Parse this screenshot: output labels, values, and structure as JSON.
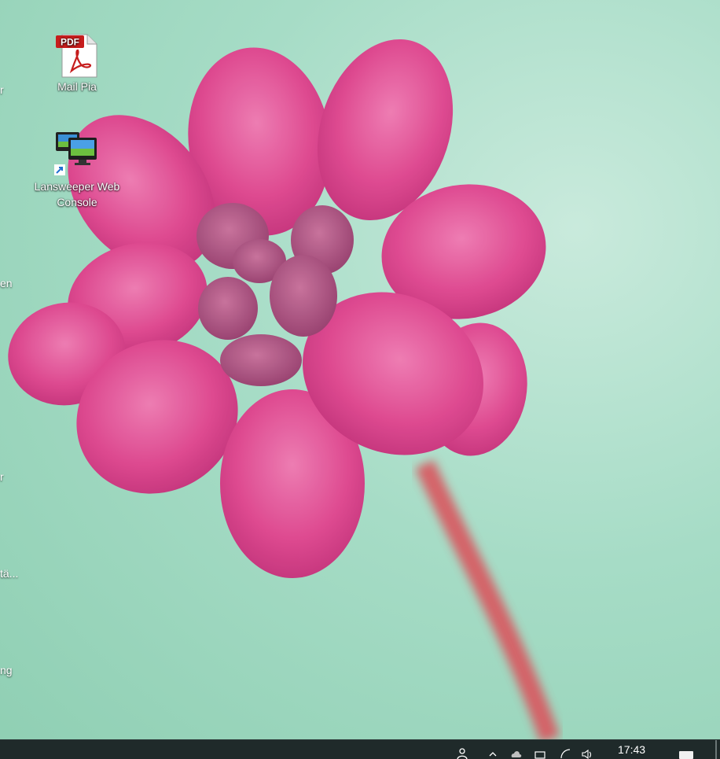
{
  "desktop": {
    "icons": [
      {
        "label": "Mail Pia",
        "icon": "pdf-file-icon"
      },
      {
        "label": "Lansweeper Web Console",
        "icon": "lansweeper-shortcut-icon"
      }
    ],
    "clipped_labels": [
      "r",
      "en",
      "r",
      "tä...",
      "ng"
    ]
  },
  "taskbar": {
    "clock": "17:43",
    "tray_icons": [
      "user-icon",
      "chevron-up-icon",
      "cloud-icon",
      "keyboard-icon",
      "network-icon",
      "volume-icon",
      "notification-icon"
    ]
  }
}
